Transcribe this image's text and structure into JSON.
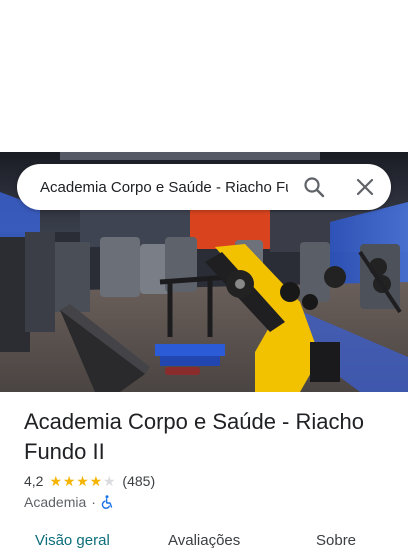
{
  "search": {
    "query": "Academia Corpo e Saúde - Riacho Fundo II"
  },
  "place": {
    "title": "Academia Corpo e Saúde - Riacho Fundo II",
    "rating": "4,2",
    "stars_value": 4.2,
    "review_count": "(485)",
    "category": "Academia",
    "separator": "·",
    "accessibility": "wheelchair-accessible-icon"
  },
  "tabs": [
    {
      "label": "Visão geral",
      "active": true
    },
    {
      "label": "Avaliações",
      "active": false
    },
    {
      "label": "Sobre",
      "active": false
    }
  ],
  "icons": {
    "search": "search-icon",
    "close": "close-icon"
  },
  "colors": {
    "star": "#f4b400",
    "accent": "#0b6e7a",
    "accessibility": "#1a73e8",
    "machine_yellow": "#f2c200"
  }
}
